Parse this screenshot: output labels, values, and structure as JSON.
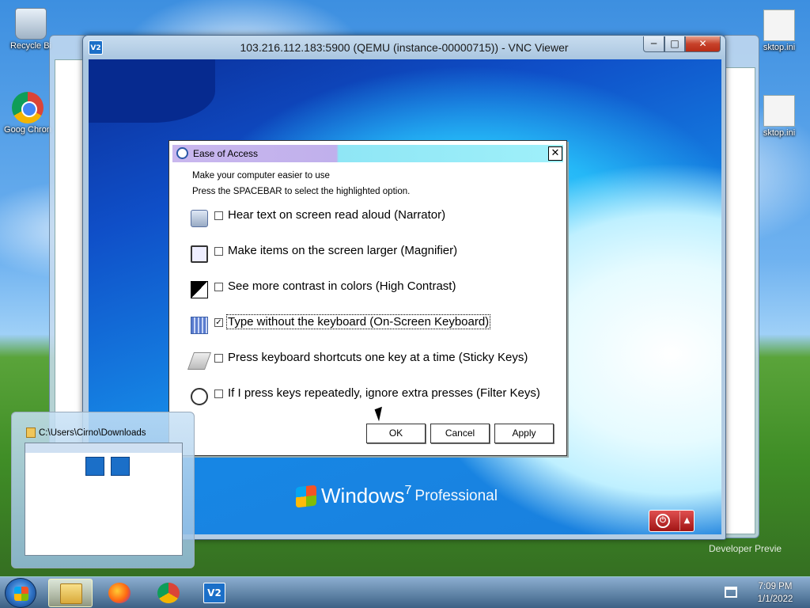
{
  "desktop": {
    "icons": [
      {
        "label": "Recycle Bi",
        "icon": "recycle-bin-icon"
      },
      {
        "label": "Goog Chron",
        "icon": "chrome-icon"
      },
      {
        "label": "sktop.ini",
        "icon": "ini-file-icon"
      },
      {
        "label": "sktop.ini",
        "icon": "ini-file-icon"
      }
    ],
    "watermark": "Developer Previe"
  },
  "vnc_window": {
    "title": "103.216.112.183:5900 (QEMU (instance-00000715)) - VNC Viewer",
    "app_icon_label": "V2",
    "min_glyph": "─",
    "max_glyph": "□",
    "close_glyph": "✕"
  },
  "remote_screen": {
    "os_logo_word": "Windows",
    "os_logo_version": "7",
    "os_logo_edition": "Professional",
    "power_glyph": "⏻",
    "power_arrow": "▲"
  },
  "ease_of_access": {
    "title": "Ease of Access",
    "close_glyph": "✕",
    "intro_line1": "Make your computer easier to use",
    "intro_line2": "Press the SPACEBAR to select the highlighted option.",
    "options": [
      {
        "label": "Hear text on screen read aloud (Narrator)",
        "checked": false,
        "icon": "narrator-icon"
      },
      {
        "label": "Make items on the screen larger (Magnifier)",
        "checked": false,
        "icon": "magnifier-icon"
      },
      {
        "label": "See more contrast in colors (High Contrast)",
        "checked": false,
        "icon": "high-contrast-icon"
      },
      {
        "label": "Type without the keyboard (On-Screen Keyboard)",
        "checked": true,
        "icon": "keyboard-icon"
      },
      {
        "label": "Press keyboard shortcuts one key at a time (Sticky Keys)",
        "checked": false,
        "icon": "sticky-keys-icon"
      },
      {
        "label": "If I press keys repeatedly, ignore extra presses (Filter Keys)",
        "checked": false,
        "icon": "filter-keys-icon"
      }
    ],
    "ok_label": "OK",
    "cancel_label": "Cancel",
    "apply_label": "Apply"
  },
  "preview": {
    "title": "C:\\Users\\Cirno\\Downloads"
  },
  "taskbar": {
    "apps": [
      {
        "name": "explorer",
        "icon": "folder-icon",
        "active": true
      },
      {
        "name": "firefox",
        "icon": "firefox-icon",
        "active": false
      },
      {
        "name": "chrome",
        "icon": "chrome-icon",
        "active": false
      },
      {
        "name": "vnc",
        "icon": "vnc-icon",
        "active": false,
        "glyph": "V2"
      }
    ],
    "time": "7:09 PM",
    "date": "1/1/2022"
  }
}
